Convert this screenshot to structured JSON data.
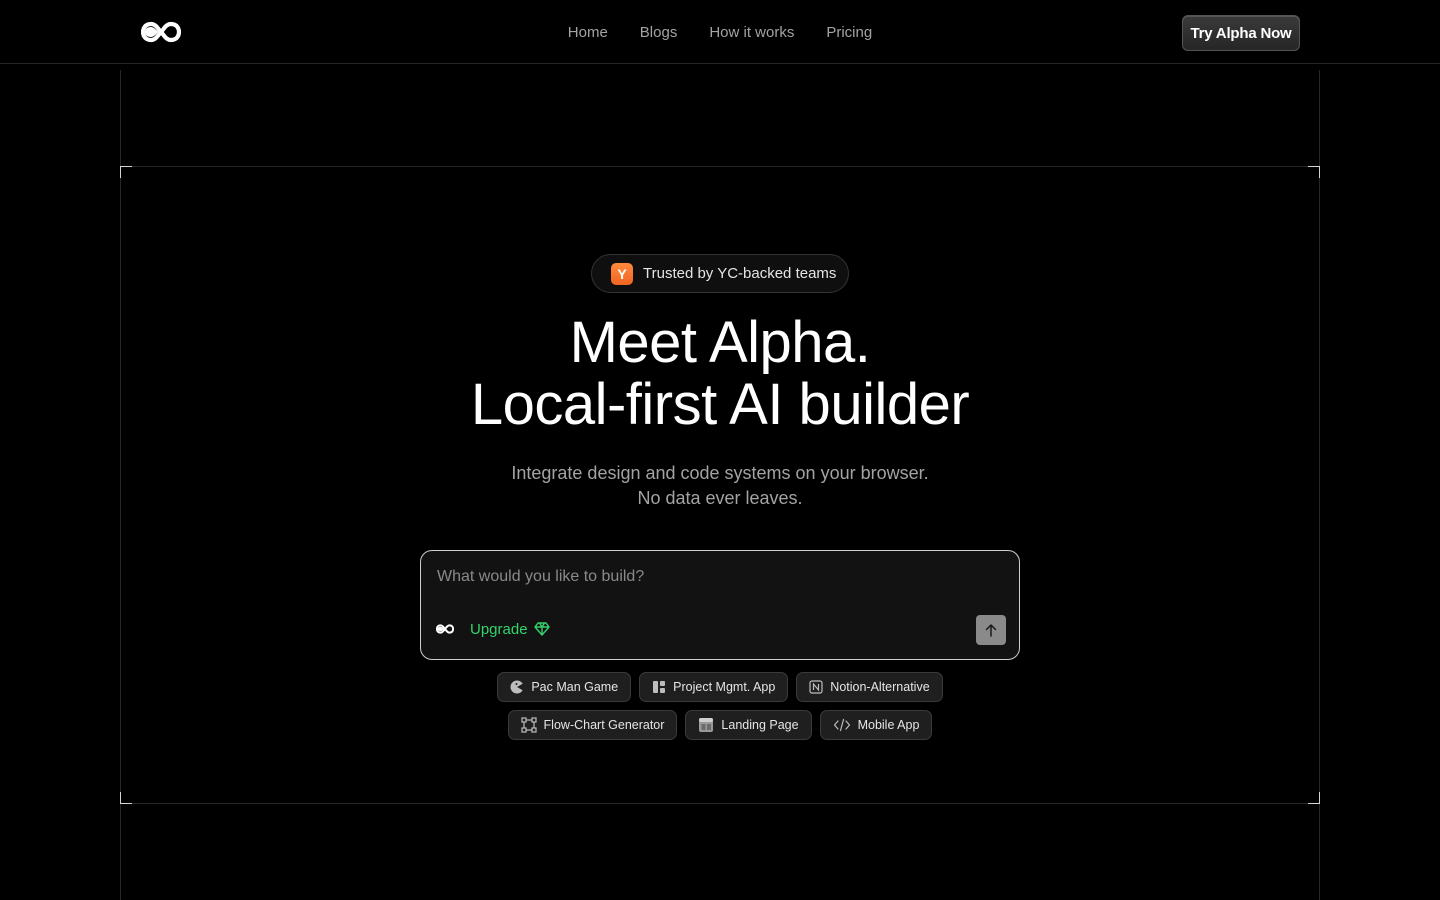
{
  "header": {
    "nav": [
      "Home",
      "Blogs",
      "How it works",
      "Pricing"
    ],
    "cta_label": "Try Alpha Now"
  },
  "hero": {
    "badge_icon_letter": "Y",
    "badge_text": "Trusted by YC-backed teams",
    "title_line1": "Meet Alpha.",
    "title_line2": "Local-first AI builder",
    "subtitle_line1": "Integrate design and code systems on your browser.",
    "subtitle_line2": "No data ever leaves."
  },
  "prompt": {
    "placeholder": "What would you like to build?",
    "value": "",
    "upgrade_label": "Upgrade"
  },
  "suggestions": [
    {
      "label": "Pac Man Game",
      "icon": "pacman-icon"
    },
    {
      "label": "Project Mgmt. App",
      "icon": "layout-icon"
    },
    {
      "label": "Notion-Alternative",
      "icon": "notion-icon"
    },
    {
      "label": "Flow-Chart Generator",
      "icon": "frame-icon"
    },
    {
      "label": "Landing Page",
      "icon": "page-icon"
    },
    {
      "label": "Mobile App",
      "icon": "code-icon"
    }
  ],
  "colors": {
    "background": "#000000",
    "upgrade_accent": "#34d36b",
    "yc_orange": "#f26522"
  }
}
